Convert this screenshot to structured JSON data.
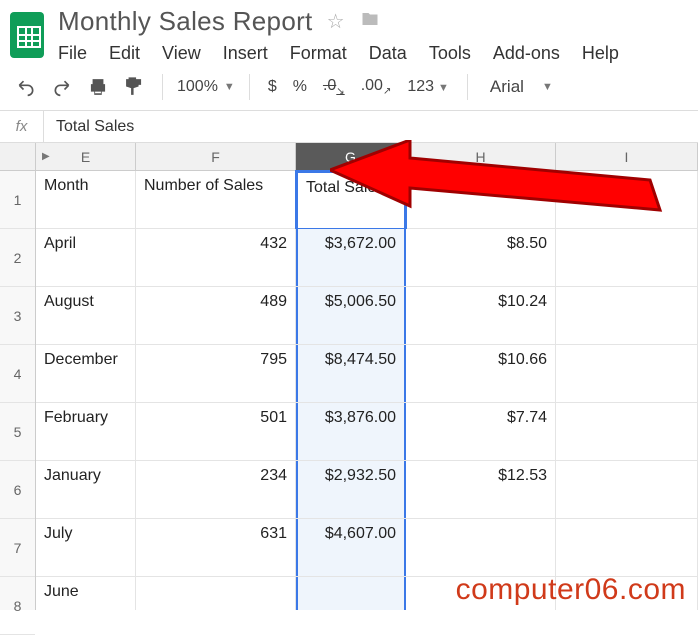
{
  "doc": {
    "title": "Monthly Sales Report"
  },
  "menu": {
    "file": "File",
    "edit": "Edit",
    "view": "View",
    "insert": "Insert",
    "format": "Format",
    "data": "Data",
    "tools": "Tools",
    "addons": "Add-ons",
    "help": "Help"
  },
  "toolbar": {
    "zoom": "100%",
    "currency": "$",
    "percent": "%",
    "dec_dec": ".0",
    "dec_inc": ".00",
    "more_fmt": "123",
    "font": "Arial"
  },
  "formula_bar": {
    "value": "Total Sales"
  },
  "columns": {
    "E": "E",
    "F": "F",
    "G": "G",
    "H": "H",
    "I": "I"
  },
  "rows": {
    "labels": [
      "1",
      "2",
      "3",
      "4",
      "5",
      "6",
      "7",
      "8"
    ],
    "header": {
      "E": "Month",
      "F": "Number of Sales",
      "G": "Total Sales",
      "H": ""
    },
    "data": [
      {
        "E": "April",
        "F": "432",
        "G": "$3,672.00",
        "H": "$8.50"
      },
      {
        "E": "August",
        "F": "489",
        "G": "$5,006.50",
        "H": "$10.24"
      },
      {
        "E": "December",
        "F": "795",
        "G": "$8,474.50",
        "H": "$10.66"
      },
      {
        "E": "February",
        "F": "501",
        "G": "$3,876.00",
        "H": "$7.74"
      },
      {
        "E": "January",
        "F": "234",
        "G": "$2,932.50",
        "H": "$12.53"
      },
      {
        "E": "July",
        "F": "631",
        "G": "$4,607.00",
        "H": ""
      },
      {
        "E": "June",
        "F": "",
        "G": "",
        "H": ""
      }
    ]
  },
  "watermark": "computer06.com"
}
